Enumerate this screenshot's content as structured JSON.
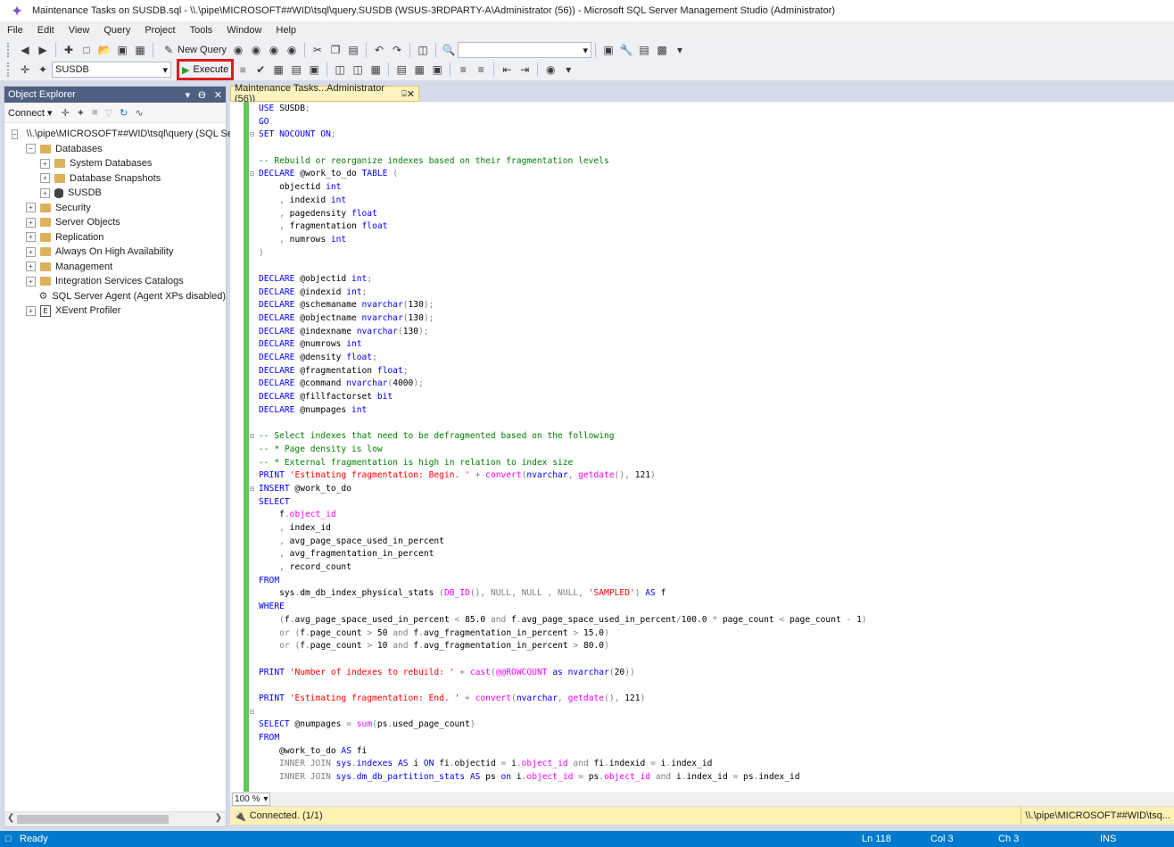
{
  "window": {
    "title": "Maintenance Tasks on SUSDB.sql - \\\\.\\pipe\\MICROSOFT##WID\\tsql\\query.SUSDB (WSUS-3RDPARTY-A\\Administrator (56)) - Microsoft SQL Server Management Studio (Administrator)"
  },
  "menu": [
    "File",
    "Edit",
    "View",
    "Query",
    "Project",
    "Tools",
    "Window",
    "Help"
  ],
  "toolbar1": {
    "new_query_label": "New Query",
    "search_value": ""
  },
  "toolbar2": {
    "database_value": "SUSDB",
    "execute_label": "Execute"
  },
  "object_explorer": {
    "title": "Object Explorer",
    "connect_label": "Connect",
    "server_node": "\\\\.\\pipe\\MICROSOFT##WID\\tsql\\query (SQL Se",
    "nodes": {
      "databases": "Databases",
      "system_databases": "System Databases",
      "database_snapshots": "Database Snapshots",
      "susdb": "SUSDB",
      "security": "Security",
      "server_objects": "Server Objects",
      "replication": "Replication",
      "always_on": "Always On High Availability",
      "management": "Management",
      "integration": "Integration Services Catalogs",
      "agent": "SQL Server Agent (Agent XPs disabled)",
      "xevent": "XEvent Profiler"
    }
  },
  "document_tab": {
    "label": "Maintenance Tasks...Administrator (56))"
  },
  "editor": {
    "zoom": "100 %",
    "lines": [
      [
        [
          "USE",
          "kw"
        ],
        [
          " SUSDB",
          "tx"
        ],
        [
          ";",
          "op"
        ]
      ],
      [
        [
          "GO",
          "kw"
        ]
      ],
      [
        [
          "SET NOCOUNT ON",
          "kw"
        ],
        [
          ";",
          "op"
        ]
      ],
      [],
      [
        [
          "-- Rebuild or reorganize indexes based on their fragmentation levels",
          "cm"
        ]
      ],
      [
        [
          "DECLARE",
          "kw"
        ],
        [
          " @work_to_do ",
          "tx"
        ],
        [
          "TABLE",
          "kw"
        ],
        [
          " (",
          "op"
        ]
      ],
      [
        [
          "    objectid ",
          "tx"
        ],
        [
          "int",
          "kw"
        ]
      ],
      [
        [
          "    ",
          "tx"
        ],
        [
          ",",
          "op"
        ],
        [
          " indexid ",
          "tx"
        ],
        [
          "int",
          "kw"
        ]
      ],
      [
        [
          "    ",
          "tx"
        ],
        [
          ",",
          "op"
        ],
        [
          " pagedensity ",
          "tx"
        ],
        [
          "float",
          "kw"
        ]
      ],
      [
        [
          "    ",
          "tx"
        ],
        [
          ",",
          "op"
        ],
        [
          " fragmentation ",
          "tx"
        ],
        [
          "float",
          "kw"
        ]
      ],
      [
        [
          "    ",
          "tx"
        ],
        [
          ",",
          "op"
        ],
        [
          " numrows ",
          "tx"
        ],
        [
          "int",
          "kw"
        ]
      ],
      [
        [
          ")",
          "op"
        ]
      ],
      [],
      [
        [
          "DECLARE",
          "kw"
        ],
        [
          " @objectid ",
          "tx"
        ],
        [
          "int",
          "kw"
        ],
        [
          ";",
          "op"
        ]
      ],
      [
        [
          "DECLARE",
          "kw"
        ],
        [
          " @indexid ",
          "tx"
        ],
        [
          "int",
          "kw"
        ],
        [
          ";",
          "op"
        ]
      ],
      [
        [
          "DECLARE",
          "kw"
        ],
        [
          " @schemaname ",
          "tx"
        ],
        [
          "nvarchar",
          "kw"
        ],
        [
          "(",
          "op"
        ],
        [
          "130",
          "tx"
        ],
        [
          ");",
          "op"
        ]
      ],
      [
        [
          "DECLARE",
          "kw"
        ],
        [
          " @objectname ",
          "tx"
        ],
        [
          "nvarchar",
          "kw"
        ],
        [
          "(",
          "op"
        ],
        [
          "130",
          "tx"
        ],
        [
          ");",
          "op"
        ]
      ],
      [
        [
          "DECLARE",
          "kw"
        ],
        [
          " @indexname ",
          "tx"
        ],
        [
          "nvarchar",
          "kw"
        ],
        [
          "(",
          "op"
        ],
        [
          "130",
          "tx"
        ],
        [
          ");",
          "op"
        ]
      ],
      [
        [
          "DECLARE",
          "kw"
        ],
        [
          " @numrows ",
          "tx"
        ],
        [
          "int",
          "kw"
        ]
      ],
      [
        [
          "DECLARE",
          "kw"
        ],
        [
          " @density ",
          "tx"
        ],
        [
          "float",
          "kw"
        ],
        [
          ";",
          "op"
        ]
      ],
      [
        [
          "DECLARE",
          "kw"
        ],
        [
          " @fragmentation ",
          "tx"
        ],
        [
          "float",
          "kw"
        ],
        [
          ";",
          "op"
        ]
      ],
      [
        [
          "DECLARE",
          "kw"
        ],
        [
          " @command ",
          "tx"
        ],
        [
          "nvarchar",
          "kw"
        ],
        [
          "(",
          "op"
        ],
        [
          "4000",
          "tx"
        ],
        [
          ");",
          "op"
        ]
      ],
      [
        [
          "DECLARE",
          "kw"
        ],
        [
          " @fillfactorset ",
          "tx"
        ],
        [
          "bit",
          "kw"
        ]
      ],
      [
        [
          "DECLARE",
          "kw"
        ],
        [
          " @numpages ",
          "tx"
        ],
        [
          "int",
          "kw"
        ]
      ],
      [],
      [
        [
          "-- Select indexes that need to be defragmented based on the following",
          "cm"
        ]
      ],
      [
        [
          "-- * Page density is low",
          "cm"
        ]
      ],
      [
        [
          "-- * External fragmentation is high in relation to index size",
          "cm"
        ]
      ],
      [
        [
          "PRINT",
          "kw"
        ],
        [
          " ",
          "tx"
        ],
        [
          "'Estimating fragmentation: Begin. '",
          "st"
        ],
        [
          " + ",
          "op"
        ],
        [
          "convert",
          "fn"
        ],
        [
          "(",
          "op"
        ],
        [
          "nvarchar",
          "kw"
        ],
        [
          ",",
          "op"
        ],
        [
          " ",
          "tx"
        ],
        [
          "getdate",
          "fn"
        ],
        [
          "(),",
          "op"
        ],
        [
          " 121",
          "tx"
        ],
        [
          ")",
          "op"
        ]
      ],
      [
        [
          "INSERT",
          "kw"
        ],
        [
          " @work_to_do",
          "tx"
        ]
      ],
      [
        [
          "SELECT",
          "kw"
        ]
      ],
      [
        [
          "    f",
          "tx"
        ],
        [
          ".",
          "op"
        ],
        [
          "object_id",
          "fn"
        ]
      ],
      [
        [
          "    ",
          "tx"
        ],
        [
          ",",
          "op"
        ],
        [
          " index_id",
          "tx"
        ]
      ],
      [
        [
          "    ",
          "tx"
        ],
        [
          ",",
          "op"
        ],
        [
          " avg_page_space_used_in_percent",
          "tx"
        ]
      ],
      [
        [
          "    ",
          "tx"
        ],
        [
          ",",
          "op"
        ],
        [
          " avg_fragmentation_in_percent",
          "tx"
        ]
      ],
      [
        [
          "    ",
          "tx"
        ],
        [
          ",",
          "op"
        ],
        [
          " record_count",
          "tx"
        ]
      ],
      [
        [
          "FROM",
          "kw"
        ]
      ],
      [
        [
          "    sys",
          "tx"
        ],
        [
          ".",
          "op"
        ],
        [
          "dm_db_index_physical_stats ",
          "tx"
        ],
        [
          "(",
          "op"
        ],
        [
          "DB_ID",
          "fn"
        ],
        [
          "(),",
          "op"
        ],
        [
          " NULL",
          "op"
        ],
        [
          ",",
          "op"
        ],
        [
          " NULL ",
          "op"
        ],
        [
          ",",
          "op"
        ],
        [
          " NULL",
          "op"
        ],
        [
          ",",
          "op"
        ],
        [
          " ",
          "tx"
        ],
        [
          "'SAMPLED'",
          "st"
        ],
        [
          ")",
          "op"
        ],
        [
          " ",
          "tx"
        ],
        [
          "AS",
          "kw"
        ],
        [
          " f",
          "tx"
        ]
      ],
      [
        [
          "WHERE",
          "kw"
        ]
      ],
      [
        [
          "    ",
          "tx"
        ],
        [
          "(",
          "op"
        ],
        [
          "f",
          "tx"
        ],
        [
          ".",
          "op"
        ],
        [
          "avg_page_space_used_in_percent ",
          "tx"
        ],
        [
          "<",
          "op"
        ],
        [
          " 85.0 ",
          "tx"
        ],
        [
          "and",
          "op"
        ],
        [
          " f",
          "tx"
        ],
        [
          ".",
          "op"
        ],
        [
          "avg_page_space_used_in_percent",
          "tx"
        ],
        [
          "/",
          "op"
        ],
        [
          "100.0 ",
          "tx"
        ],
        [
          "*",
          "op"
        ],
        [
          " page_count ",
          "tx"
        ],
        [
          "<",
          "op"
        ],
        [
          " page_count ",
          "tx"
        ],
        [
          "-",
          "op"
        ],
        [
          " 1",
          "tx"
        ],
        [
          ")",
          "op"
        ]
      ],
      [
        [
          "    ",
          "tx"
        ],
        [
          "or",
          "op"
        ],
        [
          " ",
          "tx"
        ],
        [
          "(",
          "op"
        ],
        [
          "f",
          "tx"
        ],
        [
          ".",
          "op"
        ],
        [
          "page_count ",
          "tx"
        ],
        [
          ">",
          "op"
        ],
        [
          " 50 ",
          "tx"
        ],
        [
          "and",
          "op"
        ],
        [
          " f",
          "tx"
        ],
        [
          ".",
          "op"
        ],
        [
          "avg_fragmentation_in_percent ",
          "tx"
        ],
        [
          ">",
          "op"
        ],
        [
          " 15.0",
          "tx"
        ],
        [
          ")",
          "op"
        ]
      ],
      [
        [
          "    ",
          "tx"
        ],
        [
          "or",
          "op"
        ],
        [
          " ",
          "tx"
        ],
        [
          "(",
          "op"
        ],
        [
          "f",
          "tx"
        ],
        [
          ".",
          "op"
        ],
        [
          "page_count ",
          "tx"
        ],
        [
          ">",
          "op"
        ],
        [
          " 10 ",
          "tx"
        ],
        [
          "and",
          "op"
        ],
        [
          " f",
          "tx"
        ],
        [
          ".",
          "op"
        ],
        [
          "avg_fragmentation_in_percent ",
          "tx"
        ],
        [
          ">",
          "op"
        ],
        [
          " 80.0",
          "tx"
        ],
        [
          ")",
          "op"
        ]
      ],
      [],
      [
        [
          "PRINT",
          "kw"
        ],
        [
          " ",
          "tx"
        ],
        [
          "'Number of indexes to rebuild: '",
          "st"
        ],
        [
          " + ",
          "op"
        ],
        [
          "cast",
          "fn"
        ],
        [
          "(",
          "op"
        ],
        [
          "@@ROWCOUNT",
          "fn"
        ],
        [
          " ",
          "tx"
        ],
        [
          "as",
          "kw"
        ],
        [
          " ",
          "tx"
        ],
        [
          "nvarchar",
          "kw"
        ],
        [
          "(",
          "op"
        ],
        [
          "20",
          "tx"
        ],
        [
          "))",
          "op"
        ]
      ],
      [],
      [
        [
          "PRINT",
          "kw"
        ],
        [
          " ",
          "tx"
        ],
        [
          "'Estimating fragmentation: End. '",
          "st"
        ],
        [
          " + ",
          "op"
        ],
        [
          "convert",
          "fn"
        ],
        [
          "(",
          "op"
        ],
        [
          "nvarchar",
          "kw"
        ],
        [
          ",",
          "op"
        ],
        [
          " ",
          "tx"
        ],
        [
          "getdate",
          "fn"
        ],
        [
          "(),",
          "op"
        ],
        [
          " 121",
          "tx"
        ],
        [
          ")",
          "op"
        ]
      ],
      [],
      [
        [
          "SELECT",
          "kw"
        ],
        [
          " @numpages ",
          "tx"
        ],
        [
          "=",
          "op"
        ],
        [
          " ",
          "tx"
        ],
        [
          "sum",
          "fn"
        ],
        [
          "(",
          "op"
        ],
        [
          "ps",
          "tx"
        ],
        [
          ".",
          "op"
        ],
        [
          "used_page_count",
          "tx"
        ],
        [
          ")",
          "op"
        ]
      ],
      [
        [
          "FROM",
          "kw"
        ]
      ],
      [
        [
          "    @work_to_do ",
          "tx"
        ],
        [
          "AS",
          "kw"
        ],
        [
          " fi",
          "tx"
        ]
      ],
      [
        [
          "    ",
          "tx"
        ],
        [
          "INNER JOIN",
          "op"
        ],
        [
          " sys",
          "kw"
        ],
        [
          ".",
          "op"
        ],
        [
          "indexes",
          "kw"
        ],
        [
          " ",
          "tx"
        ],
        [
          "AS",
          "kw"
        ],
        [
          " i ",
          "tx"
        ],
        [
          "ON",
          "kw"
        ],
        [
          " fi",
          "tx"
        ],
        [
          ".",
          "op"
        ],
        [
          "objectid ",
          "tx"
        ],
        [
          "=",
          "op"
        ],
        [
          " i",
          "tx"
        ],
        [
          ".",
          "op"
        ],
        [
          "object_id",
          "fn"
        ],
        [
          " ",
          "tx"
        ],
        [
          "and",
          "op"
        ],
        [
          " fi",
          "tx"
        ],
        [
          ".",
          "op"
        ],
        [
          "indexid ",
          "tx"
        ],
        [
          "=",
          "op"
        ],
        [
          " i",
          "tx"
        ],
        [
          ".",
          "op"
        ],
        [
          "index_id",
          "tx"
        ]
      ],
      [
        [
          "    ",
          "tx"
        ],
        [
          "INNER JOIN",
          "op"
        ],
        [
          " sys",
          "kw"
        ],
        [
          ".",
          "op"
        ],
        [
          "dm_db_partition_stats",
          "kw"
        ],
        [
          " ",
          "tx"
        ],
        [
          "AS",
          "kw"
        ],
        [
          " ps ",
          "tx"
        ],
        [
          "on",
          "kw"
        ],
        [
          " i",
          "tx"
        ],
        [
          ".",
          "op"
        ],
        [
          "object_id",
          "fn"
        ],
        [
          " ",
          "tx"
        ],
        [
          "=",
          "op"
        ],
        [
          " ps",
          "tx"
        ],
        [
          ".",
          "op"
        ],
        [
          "object_id",
          "fn"
        ],
        [
          " ",
          "tx"
        ],
        [
          "and",
          "op"
        ],
        [
          " i",
          "tx"
        ],
        [
          ".",
          "op"
        ],
        [
          "index_id ",
          "tx"
        ],
        [
          "=",
          "op"
        ],
        [
          " ps",
          "tx"
        ],
        [
          ".",
          "op"
        ],
        [
          "index_id",
          "tx"
        ]
      ]
    ],
    "fold_markers": [
      2,
      5,
      25,
      29,
      46
    ]
  },
  "connection_bar": {
    "status": "Connected. (1/1)",
    "server": "\\\\.\\pipe\\MICROSOFT##WID\\tsq..."
  },
  "status_bar": {
    "ready": "Ready",
    "ln": "Ln 118",
    "col": "Col 3",
    "ch": "Ch 3",
    "ins": "INS"
  }
}
